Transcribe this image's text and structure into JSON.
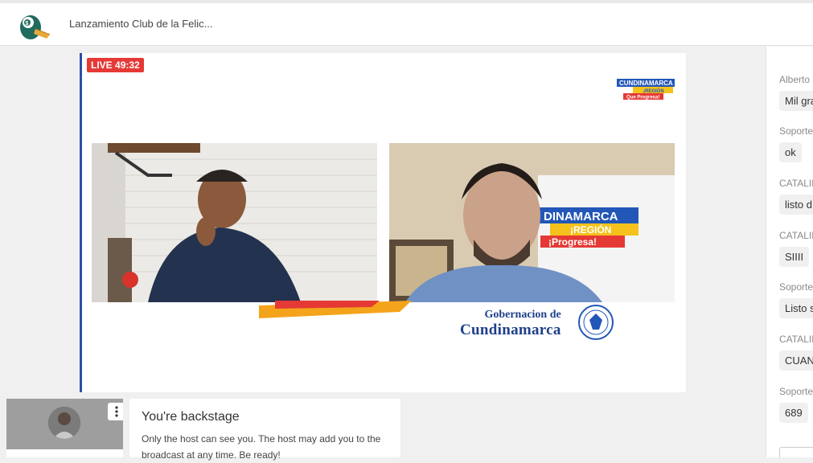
{
  "header": {
    "event_title": "Lanzamiento Club de la Felic..."
  },
  "stage": {
    "live_label": "LIVE",
    "timer": "49:32",
    "brand_logo_text": [
      "CUNDINAMARCA",
      "¡REGIÓN",
      "Que Progresa!"
    ],
    "banner_text": [
      "DINAMARCA",
      "¡REGIÓN",
      "¡Progresa!"
    ],
    "footer_line1": "Gobernacion de",
    "footer_line2": "Cundinamarca"
  },
  "backstage": {
    "title": "You're backstage",
    "message": "Only the host can see you. The host may add you to the broadcast at any time. Be ready!"
  },
  "chat": {
    "messages": [
      {
        "author": "Alberto",
        "text": "Mil gra"
      },
      {
        "author": "Soporte",
        "text": "ok"
      },
      {
        "author": "CATALIN",
        "text": "listo d"
      },
      {
        "author": "CATALIN",
        "text": "SIIII"
      },
      {
        "author": "Soporte",
        "text": "Listo s"
      },
      {
        "author": "CATALIN",
        "text": "CUANT"
      },
      {
        "author": "Soporte",
        "text": "689"
      }
    ]
  },
  "colors": {
    "live_red": "#e53935",
    "stage_border": "#2b4fa8",
    "brand_blue": "#1e3f8a"
  }
}
